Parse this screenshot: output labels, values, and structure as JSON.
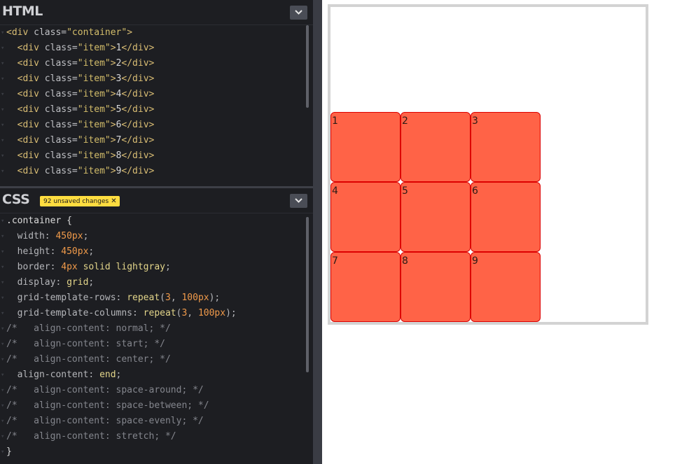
{
  "html_panel": {
    "title": "HTML",
    "code_lines": [
      {
        "indent": "",
        "open": "<div ",
        "attr": "class=",
        "val": "\"container\"",
        "close": ">",
        "text": "",
        "end": ""
      },
      {
        "indent": "  ",
        "open": "<div ",
        "attr": "class=",
        "val": "\"item\"",
        "close": ">",
        "text": "1",
        "end": "</div>"
      },
      {
        "indent": "  ",
        "open": "<div ",
        "attr": "class=",
        "val": "\"item\"",
        "close": ">",
        "text": "2",
        "end": "</div>"
      },
      {
        "indent": "  ",
        "open": "<div ",
        "attr": "class=",
        "val": "\"item\"",
        "close": ">",
        "text": "3",
        "end": "</div>"
      },
      {
        "indent": "  ",
        "open": "<div ",
        "attr": "class=",
        "val": "\"item\"",
        "close": ">",
        "text": "4",
        "end": "</div>"
      },
      {
        "indent": "  ",
        "open": "<div ",
        "attr": "class=",
        "val": "\"item\"",
        "close": ">",
        "text": "5",
        "end": "</div>"
      },
      {
        "indent": "  ",
        "open": "<div ",
        "attr": "class=",
        "val": "\"item\"",
        "close": ">",
        "text": "6",
        "end": "</div>"
      },
      {
        "indent": "  ",
        "open": "<div ",
        "attr": "class=",
        "val": "\"item\"",
        "close": ">",
        "text": "7",
        "end": "</div>"
      },
      {
        "indent": "  ",
        "open": "<div ",
        "attr": "class=",
        "val": "\"item\"",
        "close": ">",
        "text": "8",
        "end": "</div>"
      },
      {
        "indent": "  ",
        "open": "<div ",
        "attr": "class=",
        "val": "\"item\"",
        "close": ">",
        "text": "9",
        "end": "</div>"
      }
    ]
  },
  "css_panel": {
    "title": "CSS",
    "unsaved_badge": "92 unsaved changes",
    "badge_close": "✕",
    "code_lines": [
      [
        {
          "t": "sel",
          "v": ".container {"
        }
      ],
      [
        {
          "t": "prop",
          "v": "  width: "
        },
        {
          "t": "num",
          "v": "450px"
        },
        {
          "t": "prop",
          "v": ";"
        }
      ],
      [
        {
          "t": "prop",
          "v": "  height: "
        },
        {
          "t": "num",
          "v": "450px"
        },
        {
          "t": "prop",
          "v": ";"
        }
      ],
      [
        {
          "t": "prop",
          "v": "  border: "
        },
        {
          "t": "num",
          "v": "4px"
        },
        {
          "t": "kw",
          "v": " solid lightgray"
        },
        {
          "t": "prop",
          "v": ";"
        }
      ],
      [
        {
          "t": "prop",
          "v": "  display: "
        },
        {
          "t": "kw",
          "v": "grid"
        },
        {
          "t": "prop",
          "v": ";"
        }
      ],
      [
        {
          "t": "prop",
          "v": "  grid-template-rows: "
        },
        {
          "t": "fn",
          "v": "repeat"
        },
        {
          "t": "prop",
          "v": "("
        },
        {
          "t": "num",
          "v": "3"
        },
        {
          "t": "prop",
          "v": ", "
        },
        {
          "t": "num",
          "v": "100px"
        },
        {
          "t": "prop",
          "v": ");"
        }
      ],
      [
        {
          "t": "prop",
          "v": "  grid-template-columns: "
        },
        {
          "t": "fn",
          "v": "repeat"
        },
        {
          "t": "prop",
          "v": "("
        },
        {
          "t": "num",
          "v": "3"
        },
        {
          "t": "prop",
          "v": ", "
        },
        {
          "t": "num",
          "v": "100px"
        },
        {
          "t": "prop",
          "v": ");"
        }
      ],
      [
        {
          "t": "com",
          "v": "/*   align-content: normal; */"
        }
      ],
      [
        {
          "t": "com",
          "v": "/*   align-content: start; */"
        }
      ],
      [
        {
          "t": "com",
          "v": "/*   align-content: center; */"
        }
      ],
      [
        {
          "t": "prop",
          "v": "  align-content: "
        },
        {
          "t": "kw",
          "v": "end"
        },
        {
          "t": "prop",
          "v": ";"
        }
      ],
      [
        {
          "t": "com",
          "v": "/*   align-content: space-around; */"
        }
      ],
      [
        {
          "t": "com",
          "v": "/*   align-content: space-between; */"
        }
      ],
      [
        {
          "t": "com",
          "v": "/*   align-content: space-evenly; */"
        }
      ],
      [
        {
          "t": "com",
          "v": "/*   align-content: stretch; */"
        }
      ],
      [
        {
          "t": "sel",
          "v": "}"
        }
      ]
    ]
  },
  "preview": {
    "items": [
      "1",
      "2",
      "3",
      "4",
      "5",
      "6",
      "7",
      "8",
      "9"
    ]
  },
  "colors": {
    "editor_bg": "#1d1e22",
    "badge_bg": "#ffdd40",
    "item_bg": "#ff6347",
    "item_border": "#dd0000",
    "container_border": "#d3d3d3"
  },
  "icons": {
    "collapse": "chevron-down-icon",
    "gutter": "fold-arrow-icon"
  }
}
